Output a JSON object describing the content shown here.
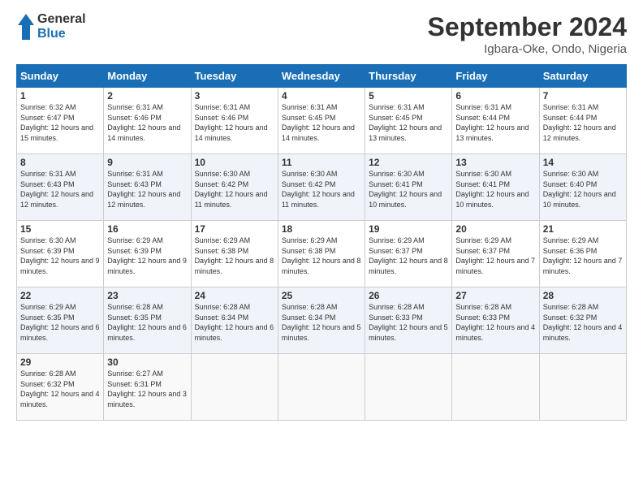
{
  "header": {
    "logo_line1": "General",
    "logo_line2": "Blue",
    "month_title": "September 2024",
    "location": "Igbara-Oke, Ondo, Nigeria"
  },
  "days_of_week": [
    "Sunday",
    "Monday",
    "Tuesday",
    "Wednesday",
    "Thursday",
    "Friday",
    "Saturday"
  ],
  "weeks": [
    [
      {
        "day": "1",
        "sunrise": "6:32 AM",
        "sunset": "6:47 PM",
        "daylight": "12 hours and 15 minutes."
      },
      {
        "day": "2",
        "sunrise": "6:31 AM",
        "sunset": "6:46 PM",
        "daylight": "12 hours and 14 minutes."
      },
      {
        "day": "3",
        "sunrise": "6:31 AM",
        "sunset": "6:46 PM",
        "daylight": "12 hours and 14 minutes."
      },
      {
        "day": "4",
        "sunrise": "6:31 AM",
        "sunset": "6:45 PM",
        "daylight": "12 hours and 14 minutes."
      },
      {
        "day": "5",
        "sunrise": "6:31 AM",
        "sunset": "6:45 PM",
        "daylight": "12 hours and 13 minutes."
      },
      {
        "day": "6",
        "sunrise": "6:31 AM",
        "sunset": "6:44 PM",
        "daylight": "12 hours and 13 minutes."
      },
      {
        "day": "7",
        "sunrise": "6:31 AM",
        "sunset": "6:44 PM",
        "daylight": "12 hours and 12 minutes."
      }
    ],
    [
      {
        "day": "8",
        "sunrise": "6:31 AM",
        "sunset": "6:43 PM",
        "daylight": "12 hours and 12 minutes."
      },
      {
        "day": "9",
        "sunrise": "6:31 AM",
        "sunset": "6:43 PM",
        "daylight": "12 hours and 12 minutes."
      },
      {
        "day": "10",
        "sunrise": "6:30 AM",
        "sunset": "6:42 PM",
        "daylight": "12 hours and 11 minutes."
      },
      {
        "day": "11",
        "sunrise": "6:30 AM",
        "sunset": "6:42 PM",
        "daylight": "12 hours and 11 minutes."
      },
      {
        "day": "12",
        "sunrise": "6:30 AM",
        "sunset": "6:41 PM",
        "daylight": "12 hours and 10 minutes."
      },
      {
        "day": "13",
        "sunrise": "6:30 AM",
        "sunset": "6:41 PM",
        "daylight": "12 hours and 10 minutes."
      },
      {
        "day": "14",
        "sunrise": "6:30 AM",
        "sunset": "6:40 PM",
        "daylight": "12 hours and 10 minutes."
      }
    ],
    [
      {
        "day": "15",
        "sunrise": "6:30 AM",
        "sunset": "6:39 PM",
        "daylight": "12 hours and 9 minutes."
      },
      {
        "day": "16",
        "sunrise": "6:29 AM",
        "sunset": "6:39 PM",
        "daylight": "12 hours and 9 minutes."
      },
      {
        "day": "17",
        "sunrise": "6:29 AM",
        "sunset": "6:38 PM",
        "daylight": "12 hours and 8 minutes."
      },
      {
        "day": "18",
        "sunrise": "6:29 AM",
        "sunset": "6:38 PM",
        "daylight": "12 hours and 8 minutes."
      },
      {
        "day": "19",
        "sunrise": "6:29 AM",
        "sunset": "6:37 PM",
        "daylight": "12 hours and 8 minutes."
      },
      {
        "day": "20",
        "sunrise": "6:29 AM",
        "sunset": "6:37 PM",
        "daylight": "12 hours and 7 minutes."
      },
      {
        "day": "21",
        "sunrise": "6:29 AM",
        "sunset": "6:36 PM",
        "daylight": "12 hours and 7 minutes."
      }
    ],
    [
      {
        "day": "22",
        "sunrise": "6:29 AM",
        "sunset": "6:35 PM",
        "daylight": "12 hours and 6 minutes."
      },
      {
        "day": "23",
        "sunrise": "6:28 AM",
        "sunset": "6:35 PM",
        "daylight": "12 hours and 6 minutes."
      },
      {
        "day": "24",
        "sunrise": "6:28 AM",
        "sunset": "6:34 PM",
        "daylight": "12 hours and 6 minutes."
      },
      {
        "day": "25",
        "sunrise": "6:28 AM",
        "sunset": "6:34 PM",
        "daylight": "12 hours and 5 minutes."
      },
      {
        "day": "26",
        "sunrise": "6:28 AM",
        "sunset": "6:33 PM",
        "daylight": "12 hours and 5 minutes."
      },
      {
        "day": "27",
        "sunrise": "6:28 AM",
        "sunset": "6:33 PM",
        "daylight": "12 hours and 4 minutes."
      },
      {
        "day": "28",
        "sunrise": "6:28 AM",
        "sunset": "6:32 PM",
        "daylight": "12 hours and 4 minutes."
      }
    ],
    [
      {
        "day": "29",
        "sunrise": "6:28 AM",
        "sunset": "6:32 PM",
        "daylight": "12 hours and 4 minutes."
      },
      {
        "day": "30",
        "sunrise": "6:27 AM",
        "sunset": "6:31 PM",
        "daylight": "12 hours and 3 minutes."
      },
      {
        "day": "",
        "sunrise": "",
        "sunset": "",
        "daylight": ""
      },
      {
        "day": "",
        "sunrise": "",
        "sunset": "",
        "daylight": ""
      },
      {
        "day": "",
        "sunrise": "",
        "sunset": "",
        "daylight": ""
      },
      {
        "day": "",
        "sunrise": "",
        "sunset": "",
        "daylight": ""
      },
      {
        "day": "",
        "sunrise": "",
        "sunset": "",
        "daylight": ""
      }
    ]
  ]
}
